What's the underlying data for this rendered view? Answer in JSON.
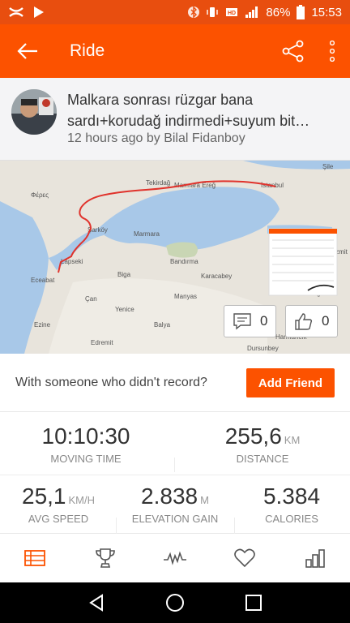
{
  "status_bar": {
    "battery": "86%",
    "time": "15:53"
  },
  "app_bar": {
    "title": "Ride"
  },
  "activity": {
    "title": "Malkara sonrası rüzgar bana sardı+korudağ indirmedi+suyum bit…",
    "meta": "12 hours ago by Bilal Fidanboy"
  },
  "map": {
    "labels": [
      "Tekirdağ",
      "Marmara Ereğlisi",
      "İstanbul",
      "Silivri",
      "Şarköy",
      "Marmara",
      "Lapseki",
      "Bandırma",
      "Biga",
      "Karacabey",
      "Manyas",
      "Çan",
      "Yenice",
      "Balya",
      "Ezine",
      "Edremit",
      "Dursunbey",
      "Harmancık",
      "İnegöl",
      "Eceabat",
      "Şile",
      "İzmit"
    ],
    "comments_count": "0",
    "kudos_count": "0"
  },
  "friend_prompt": {
    "text": "With someone who didn't record?",
    "button_label": "Add Friend"
  },
  "stats": {
    "moving_time": {
      "value": "10:10:30",
      "unit": "",
      "label": "MOVING TIME"
    },
    "distance": {
      "value": "255,6",
      "unit": "KM",
      "label": "DISTANCE"
    },
    "avg_speed": {
      "value": "25,1",
      "unit": "KM/H",
      "label": "AVG SPEED"
    },
    "elevation_gain": {
      "value": "2.838",
      "unit": "M",
      "label": "ELEVATION GAIN"
    },
    "calories": {
      "value": "5.384",
      "unit": "",
      "label": "CALORIES"
    }
  },
  "tabs": [
    {
      "name": "overview-tab",
      "icon": "list-icon",
      "active": true
    },
    {
      "name": "achievements-tab",
      "icon": "trophy-icon",
      "active": false
    },
    {
      "name": "analysis-tab",
      "icon": "pulse-icon",
      "active": false
    },
    {
      "name": "kudos-tab",
      "icon": "heart-icon",
      "active": false
    },
    {
      "name": "stats-tab",
      "icon": "bar-chart-icon",
      "active": false
    }
  ],
  "colors": {
    "brand": "#fc5200",
    "status_bar": "#e84e0f",
    "route": "#e0332c",
    "water": "#a8c8e8"
  }
}
